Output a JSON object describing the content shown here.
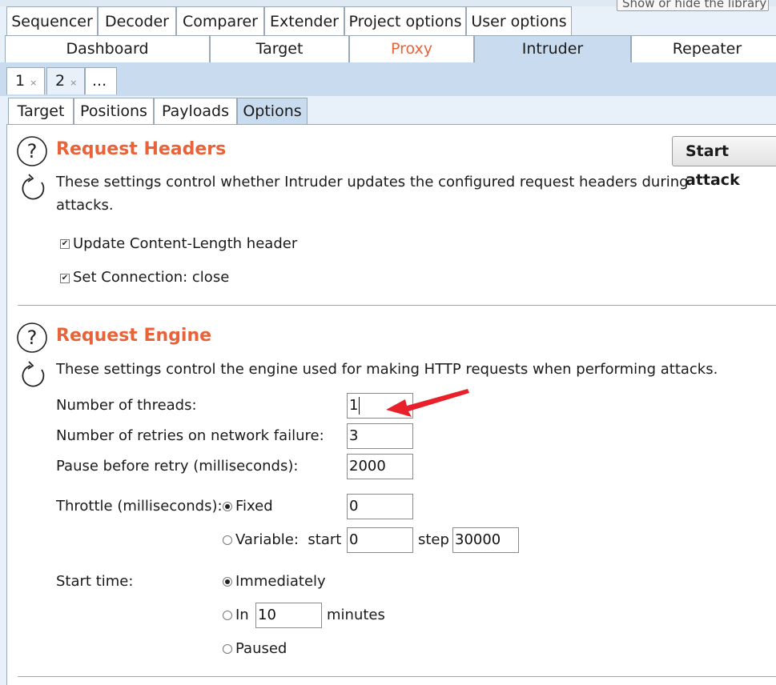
{
  "tooltip": "Show or hide the library",
  "tool_tabs": [
    "Sequencer",
    "Decoder",
    "Comparer",
    "Extender",
    "Project options",
    "User options"
  ],
  "module_tabs": [
    "Dashboard",
    "Target",
    "Proxy",
    "Intruder",
    "Repeater"
  ],
  "attack_tabs": {
    "tab1": "1",
    "tab2": "2",
    "more": "...",
    "close": "×"
  },
  "sub_tabs": [
    "Target",
    "Positions",
    "Payloads",
    "Options"
  ],
  "start_attack": "Start attack",
  "request_headers": {
    "title": "Request Headers",
    "desc_line1": "These settings control whether Intruder updates the configured request headers during",
    "desc_line2": "attacks.",
    "opt1": "Update Content-Length header",
    "opt2": "Set Connection: close"
  },
  "request_engine": {
    "title": "Request Engine",
    "desc": "These settings control the engine used for making HTTP requests when performing attacks.",
    "threads_label": "Number of threads:",
    "threads_value": "1",
    "retries_label": "Number of retries on network failure:",
    "retries_value": "3",
    "pause_label": "Pause before retry (milliseconds):",
    "pause_value": "2000",
    "throttle_label": "Throttle (milliseconds):",
    "fixed_label": "Fixed",
    "fixed_value": "0",
    "variable_label": "Variable:  start",
    "variable_start": "0",
    "step_label": "step",
    "step_value": "30000",
    "start_time_label": "Start time:",
    "immediately_label": "Immediately",
    "in_label": "In",
    "in_value": "10",
    "minutes_label": "minutes",
    "paused_label": "Paused"
  },
  "colors": {
    "accent": "#e8633a",
    "selected_tab": "#c9dcef",
    "arrow": "#e8202a"
  }
}
